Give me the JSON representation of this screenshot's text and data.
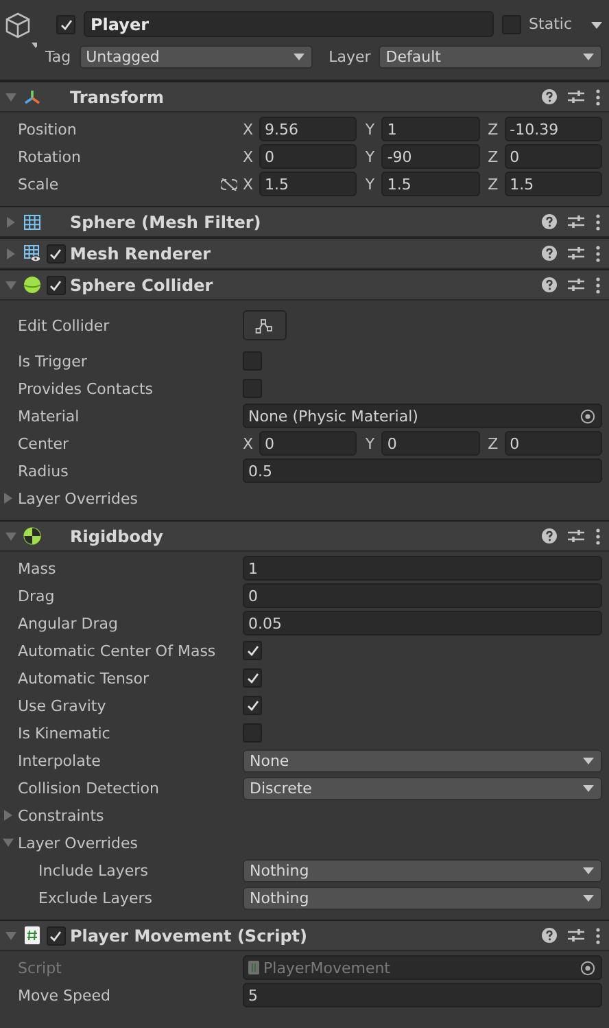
{
  "object": {
    "active": true,
    "name": "Player",
    "static": false,
    "static_label": "Static",
    "tag_label": "Tag",
    "tag": "Untagged",
    "layer_label": "Layer",
    "layer": "Default"
  },
  "components": [
    {
      "kind": "transform",
      "title": "Transform",
      "expanded": true,
      "properties": [
        {
          "kind": "vector",
          "label": "Position",
          "axes": [
            {
              "axis": "X",
              "value": "9.56"
            },
            {
              "axis": "Y",
              "value": "1"
            },
            {
              "axis": "Z",
              "value": "-10.39"
            }
          ]
        },
        {
          "kind": "vector",
          "label": "Rotation",
          "axes": [
            {
              "axis": "X",
              "value": "0"
            },
            {
              "axis": "Y",
              "value": "-90"
            },
            {
              "axis": "Z",
              "value": "0"
            }
          ]
        },
        {
          "kind": "vector",
          "label": "Scale",
          "link_toggle": true,
          "axes": [
            {
              "axis": "X",
              "value": "1.5"
            },
            {
              "axis": "Y",
              "value": "1.5"
            },
            {
              "axis": "Z",
              "value": "1.5"
            }
          ]
        }
      ]
    },
    {
      "kind": "mesh_filter",
      "title": "Sphere (Mesh Filter)",
      "expanded": false
    },
    {
      "kind": "mesh_renderer",
      "title": "Mesh Renderer",
      "enabled": true,
      "expanded": false
    },
    {
      "kind": "sphere_collider",
      "title": "Sphere Collider",
      "enabled": true,
      "expanded": true,
      "properties": [
        {
          "kind": "button",
          "label": "Edit Collider"
        },
        {
          "kind": "toggle",
          "label": "Is Trigger",
          "checked": false
        },
        {
          "kind": "toggle",
          "label": "Provides Contacts",
          "checked": false
        },
        {
          "kind": "object",
          "label": "Material",
          "value": "None (Physic Material)"
        },
        {
          "kind": "vector",
          "label": "Center",
          "axes": [
            {
              "axis": "X",
              "value": "0"
            },
            {
              "axis": "Y",
              "value": "0"
            },
            {
              "axis": "Z",
              "value": "0"
            }
          ]
        },
        {
          "kind": "number",
          "label": "Radius",
          "value": "0.5"
        },
        {
          "kind": "foldout",
          "label": "Layer Overrides",
          "expanded": false
        }
      ]
    },
    {
      "kind": "rigidbody",
      "title": "Rigidbody",
      "expanded": true,
      "properties": [
        {
          "kind": "number",
          "label": "Mass",
          "value": "1"
        },
        {
          "kind": "number",
          "label": "Drag",
          "value": "0"
        },
        {
          "kind": "number",
          "label": "Angular Drag",
          "value": "0.05"
        },
        {
          "kind": "toggle",
          "label": "Automatic Center Of Mass",
          "checked": true
        },
        {
          "kind": "toggle",
          "label": "Automatic Tensor",
          "checked": true
        },
        {
          "kind": "toggle",
          "label": "Use Gravity",
          "checked": true
        },
        {
          "kind": "toggle",
          "label": "Is Kinematic",
          "checked": false
        },
        {
          "kind": "enum",
          "label": "Interpolate",
          "value": "None"
        },
        {
          "kind": "enum",
          "label": "Collision Detection",
          "value": "Discrete"
        },
        {
          "kind": "foldout",
          "label": "Constraints",
          "expanded": false
        },
        {
          "kind": "foldout",
          "label": "Layer Overrides",
          "expanded": true,
          "children": [
            {
              "kind": "enum",
              "label": "Include Layers",
              "value": "Nothing"
            },
            {
              "kind": "enum",
              "label": "Exclude Layers",
              "value": "Nothing"
            }
          ]
        }
      ]
    },
    {
      "kind": "script",
      "title": "Player Movement (Script)",
      "enabled": true,
      "expanded": true,
      "properties": [
        {
          "kind": "object",
          "label": "Script",
          "value": "PlayerMovement",
          "disabled": true,
          "script_icon": true
        },
        {
          "kind": "number",
          "label": "Move Speed",
          "value": "5"
        }
      ]
    }
  ]
}
